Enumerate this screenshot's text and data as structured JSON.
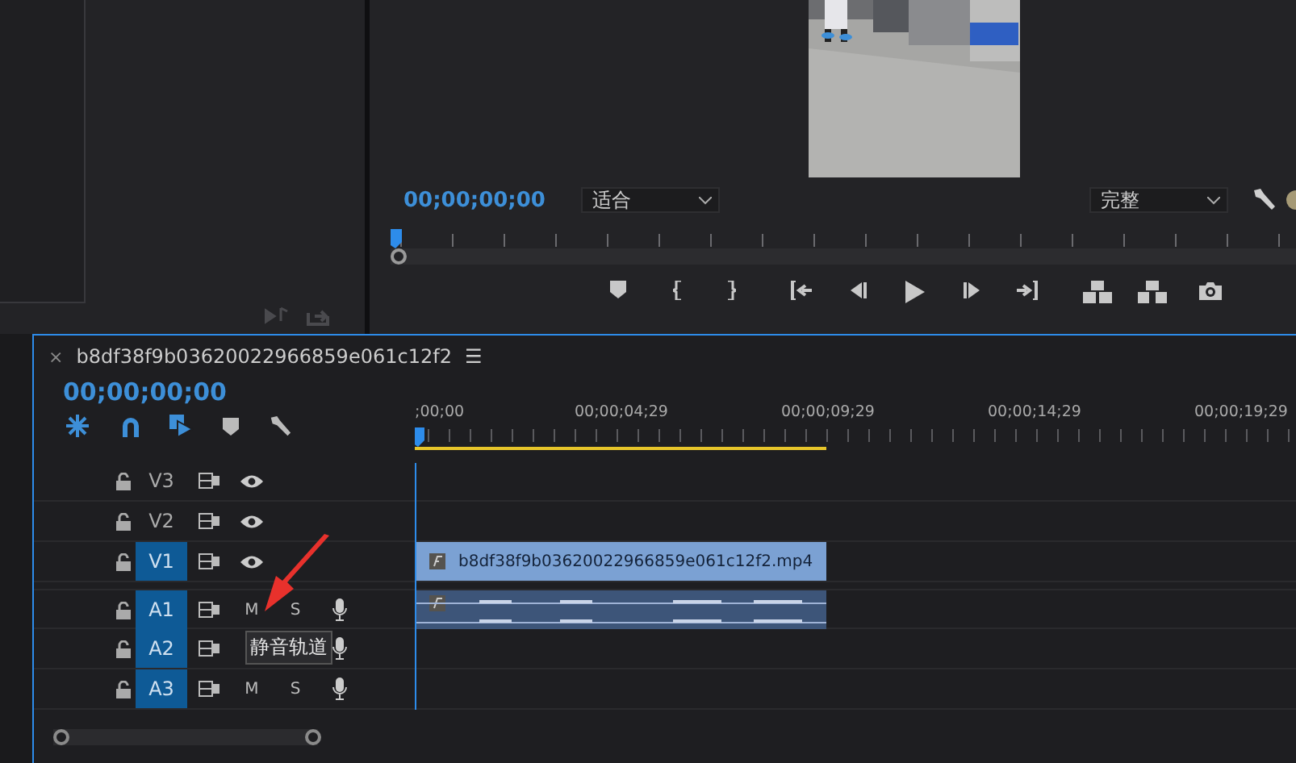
{
  "program_monitor": {
    "timecode": "00;00;00;00",
    "zoom_dropdown": {
      "value": "适合"
    },
    "quality_dropdown": {
      "value": "完整"
    }
  },
  "timeline": {
    "tab_title": "b8df38f9b03620022966859e061c12f2",
    "menu_glyph": "☰",
    "close_glyph": "×",
    "timecode": "00;00;00;00",
    "ruler_labels": [
      ";00;00",
      "00;00;04;29",
      "00;00;09;29",
      "00;00;14;29",
      "00;00;19;29"
    ],
    "tracks": [
      {
        "name": "V3",
        "kind": "video",
        "targeted": false
      },
      {
        "name": "V2",
        "kind": "video",
        "targeted": false
      },
      {
        "name": "V1",
        "kind": "video",
        "targeted": true,
        "clip": {
          "kind": "video",
          "label": "b8df38f9b03620022966859e061c12f2.mp4"
        }
      },
      {
        "name": "A1",
        "kind": "audio",
        "targeted": true,
        "mute": "M",
        "solo": "S",
        "clip": {
          "kind": "audio"
        }
      },
      {
        "name": "A2",
        "kind": "audio",
        "targeted": true,
        "tooltip": "静音轨道"
      },
      {
        "name": "A3",
        "kind": "audio",
        "targeted": true,
        "mute": "M",
        "solo": "S"
      }
    ]
  }
}
